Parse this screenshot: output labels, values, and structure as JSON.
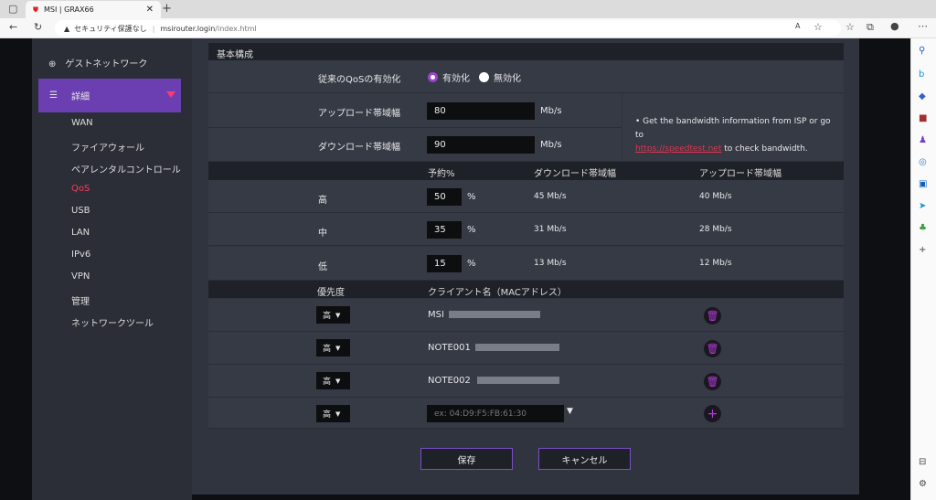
{
  "browser": {
    "tab_title": "MSI | GRAX66",
    "security": "セキュリティ保護なし",
    "url_host": "msirouter.login",
    "url_path": "/index.html"
  },
  "sidebar": {
    "guest": "ゲストネットワーク",
    "advanced": "詳細",
    "items": [
      "WAN",
      "ファイアウォール",
      "ペアレンタルコントロール",
      "QoS",
      "USB",
      "LAN",
      "IPv6",
      "VPN",
      "管理",
      "ネットワークツール"
    ]
  },
  "qos": {
    "section": "基本構成",
    "enable_label": "従来のQoSの有効化",
    "enable": "有効化",
    "disable": "無効化",
    "upload_label": "アップロード帯域幅",
    "upload_value": "80",
    "download_label": "ダウンロード帯域幅",
    "download_value": "90",
    "unit": "Mb/s",
    "info_text": "Get the bandwidth information from ISP or go to",
    "info_link": "https://speedtest.net",
    "info_tail": "to check bandwidth.",
    "table_headers": [
      "予約%",
      "ダウンロード帯域幅",
      "アップロード帯域幅"
    ],
    "levels": [
      {
        "name": "高",
        "percent": "50",
        "down": "45 Mb/s",
        "up": "40 Mb/s"
      },
      {
        "name": "中",
        "percent": "35",
        "down": "31 Mb/s",
        "up": "28 Mb/s"
      },
      {
        "name": "低",
        "percent": "15",
        "down": "13 Mb/s",
        "up": "12 Mb/s"
      }
    ],
    "pct": "%",
    "client_headers": [
      "優先度",
      "クライアント名（MACアドレス）"
    ],
    "clients": [
      {
        "priority": "高",
        "name": "MSI"
      },
      {
        "priority": "高",
        "name": "NOTE001"
      },
      {
        "priority": "高",
        "name": "NOTE002"
      }
    ],
    "new_priority": "高",
    "mac_placeholder": "ex: 04:D9:F5:FB:61:30",
    "save": "保存",
    "cancel": "キャンセル"
  }
}
